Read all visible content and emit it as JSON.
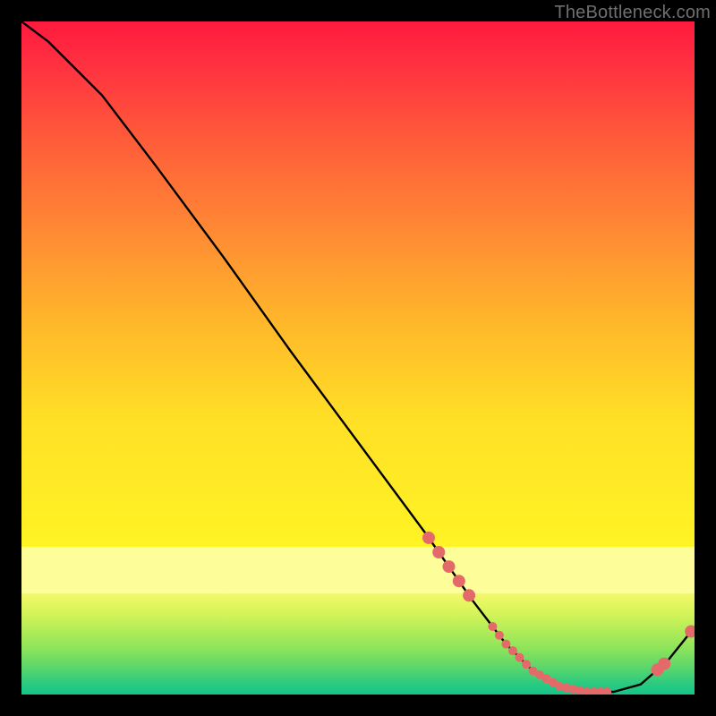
{
  "watermark": "TheBottleneck.com",
  "chart_data": {
    "type": "line",
    "title": "",
    "xlabel": "",
    "ylabel": "",
    "xlim": [
      0,
      100
    ],
    "ylim": [
      0,
      100
    ],
    "grid": false,
    "legend": false,
    "background_gradient_stops": [
      {
        "pos": 0,
        "color": "#ff1a3e"
      },
      {
        "pos": 40,
        "color": "#ff8a34"
      },
      {
        "pos": 70,
        "color": "#fff424"
      },
      {
        "pos": 78,
        "color": "#fdfd9a"
      },
      {
        "pos": 85,
        "color": "#d8f45a"
      },
      {
        "pos": 100,
        "color": "#14c58c"
      }
    ],
    "series": [
      {
        "name": "bottleneck-curve",
        "color": "#000000",
        "x": [
          0,
          4,
          8,
          12,
          20,
          30,
          40,
          50,
          60,
          67,
          72,
          76,
          80,
          84,
          88,
          92,
          96,
          100
        ],
        "y": [
          100,
          97,
          93,
          89,
          78.5,
          65,
          51,
          37.5,
          24,
          14,
          7.5,
          3.5,
          1.2,
          0.4,
          0.4,
          1.5,
          5,
          10
        ]
      }
    ],
    "marker_points": {
      "comment": "Pink dots rendered along the curve near the trough",
      "color": "#e46a6a",
      "radius_small": 5,
      "radius_large": 7,
      "x": [
        60.5,
        62,
        63.5,
        65,
        66.5,
        70,
        71,
        72,
        73,
        74,
        75,
        76,
        77,
        78,
        79,
        80,
        81,
        82,
        83,
        84,
        85,
        86,
        87,
        94.5,
        95.5,
        99.5
      ],
      "size": [
        "l",
        "l",
        "l",
        "l",
        "l",
        "s",
        "s",
        "s",
        "s",
        "s",
        "s",
        "s",
        "s",
        "s",
        "s",
        "s",
        "s",
        "s",
        "s",
        "s",
        "s",
        "s",
        "s",
        "l",
        "l",
        "l"
      ]
    }
  }
}
